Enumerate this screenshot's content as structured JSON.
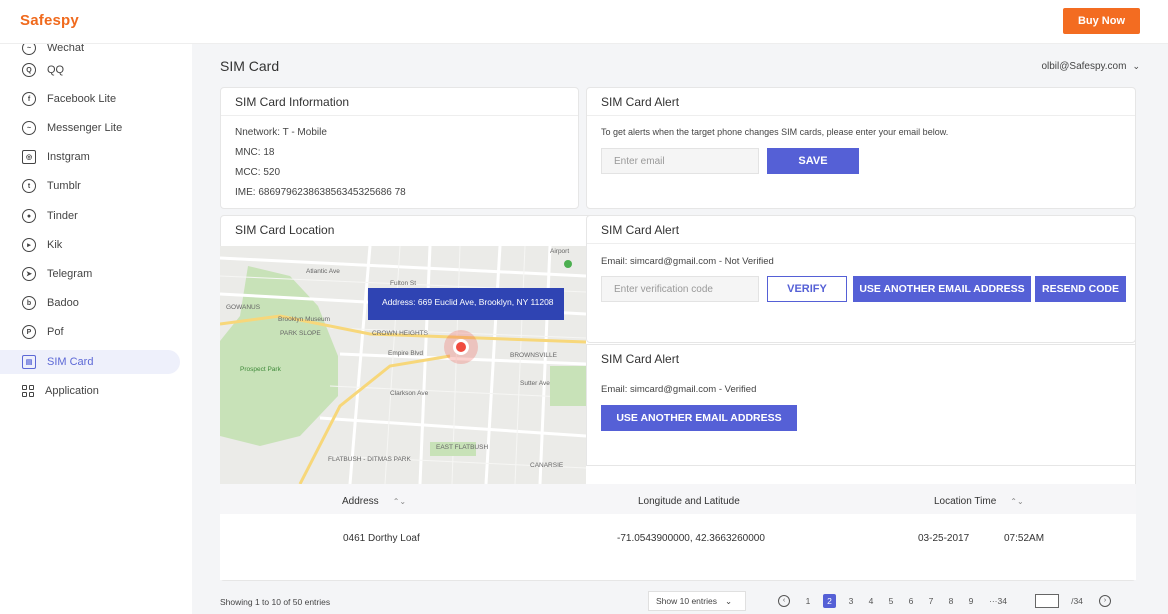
{
  "app": {
    "logo": "Safespy",
    "buy_label": "Buy Now"
  },
  "sidebar": {
    "partial_item": "Wechat",
    "items": [
      {
        "label": "QQ",
        "icon": "qq-icon",
        "glyph": "Q"
      },
      {
        "label": "Facebook Lite",
        "icon": "facebook-icon",
        "glyph": "f"
      },
      {
        "label": "Messenger Lite",
        "icon": "messenger-icon",
        "glyph": "~"
      },
      {
        "label": "Instgram",
        "icon": "instagram-icon",
        "glyph": "◎"
      },
      {
        "label": "Tumblr",
        "icon": "tumblr-icon",
        "glyph": "t"
      },
      {
        "label": "Tinder",
        "icon": "tinder-icon",
        "glyph": "●"
      },
      {
        "label": "Kik",
        "icon": "kik-icon",
        "glyph": "▸"
      },
      {
        "label": "Telegram",
        "icon": "telegram-icon",
        "glyph": "➤"
      },
      {
        "label": "Badoo",
        "icon": "badoo-icon",
        "glyph": "b"
      },
      {
        "label": "Pof",
        "icon": "pof-icon",
        "glyph": "P"
      },
      {
        "label": "SIM Card",
        "icon": "sim-card-icon",
        "glyph": "▤"
      },
      {
        "label": "Application",
        "icon": "application-icon",
        "glyph": ""
      }
    ]
  },
  "header": {
    "title": "SIM Card",
    "user_email": "olbil@Safespy.com",
    "chevron": "⌄"
  },
  "sim_info": {
    "title": "SIM Card Information",
    "network": "Nnetwork:  T - Mobile",
    "mnc": "MNC:  18",
    "mcc": "MCC:  520",
    "ime": "IME:  686979623863856345325686 78"
  },
  "alert_email": {
    "title": "SIM Card Alert",
    "description": "To get alerts when the target phone changes SIM cards, please enter your email below.",
    "placeholder": "Enter email",
    "save_label": "SAVE"
  },
  "location": {
    "title": "SIM Card Location",
    "tooltip_address": "Address: 669 Euclid Ave, Brooklyn, NY 11208",
    "map_labels": [
      "Brooklyn Museum",
      "PARK SLOPE",
      "CROWN HEIGHTS",
      "BROWNSVILLE",
      "Prospect Park",
      "GOWANUS",
      "EAST FLATBUSH",
      "FLATBUSH - DITMAS PARK",
      "CANARSIE",
      "Empire Blvd",
      "Fulton St",
      "Atlantic Ave",
      "Clarkson Ave",
      "Sutter Ave",
      "Airport"
    ]
  },
  "alert_unverified": {
    "title": "SIM Card Alert",
    "status": "Email: simcard@gmail.com - Not Verified",
    "placeholder": "Enter verification code",
    "verify_label": "VERIFY",
    "another_label": "USE ANOTHER EMAIL ADDRESS",
    "resend_label": "RESEND CODE"
  },
  "alert_verified": {
    "title": "SIM Card Alert",
    "status": "Email: simcard@gmail.com - Verified",
    "another_label": "USE ANOTHER EMAIL ADDRESS"
  },
  "table": {
    "headers": {
      "address": "Address",
      "coords": "Longitude and Latitude",
      "time": "Location Time"
    },
    "sort_icon": "⌃⌄",
    "rows": [
      {
        "address": "0461 Dorthy Loaf",
        "coords": "-71.0543900000, 42.3663260000",
        "date": "03-25-2017",
        "time": "07:52AM"
      }
    ]
  },
  "footer": {
    "entries_text": "Showing 1 to 10 of 50 entries",
    "show_label": "Show 10 entries",
    "chevron": "⌄",
    "pages": [
      "1",
      "2",
      "3",
      "4",
      "5",
      "6",
      "7",
      "8",
      "9",
      "···34"
    ],
    "active_page": "2",
    "page_total": "/34",
    "prev_icon": "‹",
    "next_icon": "›"
  }
}
